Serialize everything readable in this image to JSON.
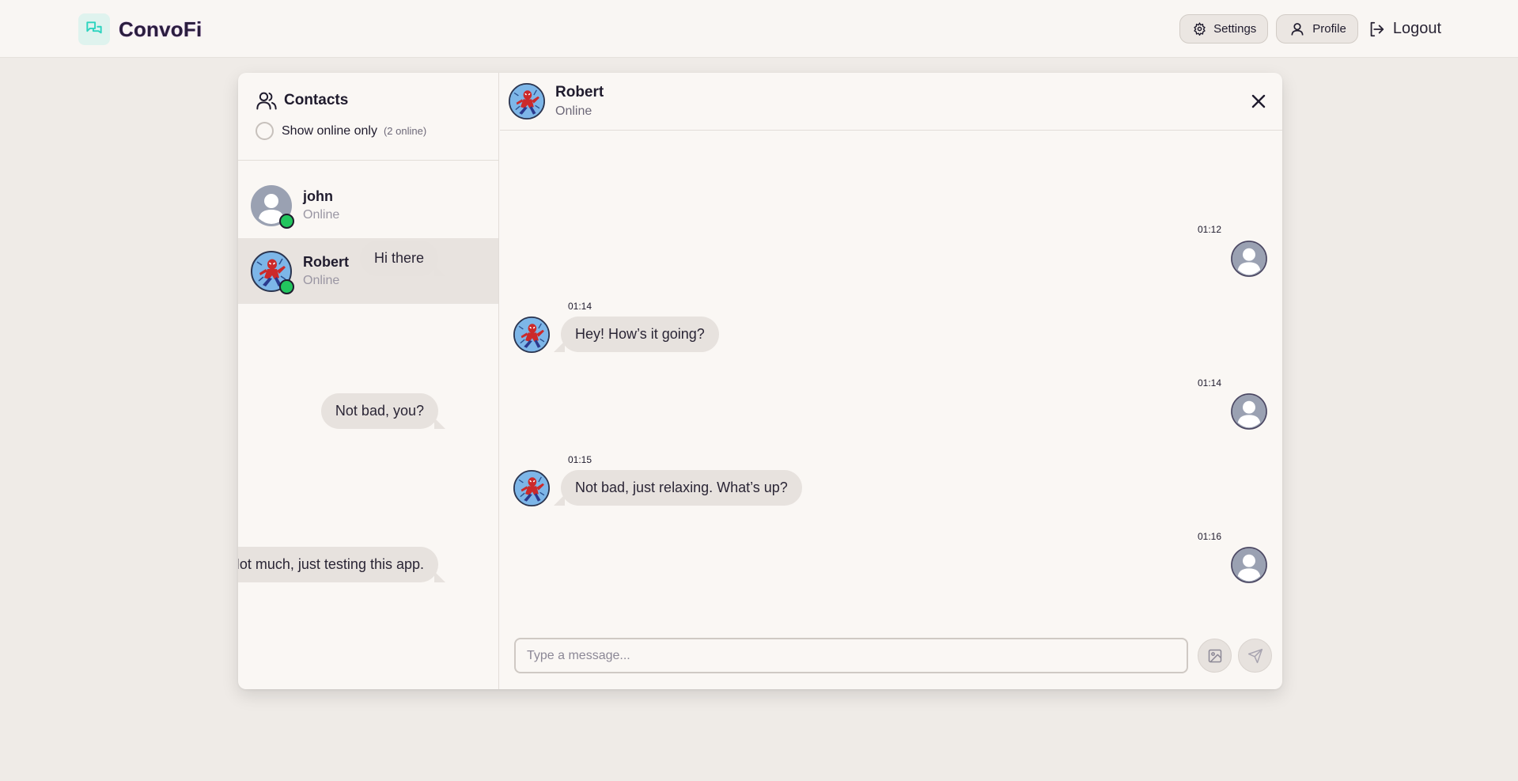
{
  "app": {
    "name": "ConvoFi"
  },
  "nav": {
    "settings_label": "Settings",
    "profile_label": "Profile",
    "logout_label": "Logout"
  },
  "contacts": {
    "title": "Contacts",
    "filter_label": "Show online only",
    "online_count": "(2 online)",
    "items": [
      {
        "name": "john",
        "status": "Online",
        "avatar": "default-user-avatar",
        "online": true
      },
      {
        "name": "Robert",
        "status": "Online",
        "avatar": "spiderman-avatar",
        "online": true,
        "active": true
      }
    ]
  },
  "chat": {
    "name": "Robert",
    "status": "Online",
    "messages": [
      {
        "time": "01:12",
        "text": "Hi there",
        "direction": "out"
      },
      {
        "time": "01:14",
        "text": "Hey! How’s it going?",
        "direction": "in"
      },
      {
        "time": "01:14",
        "text": "Not bad, you?",
        "direction": "out"
      },
      {
        "time": "01:15",
        "text": "Not bad, just relaxing. What’s up?",
        "direction": "in"
      },
      {
        "time": "01:16",
        "text": "Not much, just testing this app.",
        "direction": "out"
      }
    ],
    "input_placeholder": "Type a message..."
  },
  "colors": {
    "online": "#22c55e",
    "accent": "#2dd4bf",
    "bubble": "#e7e2de"
  }
}
